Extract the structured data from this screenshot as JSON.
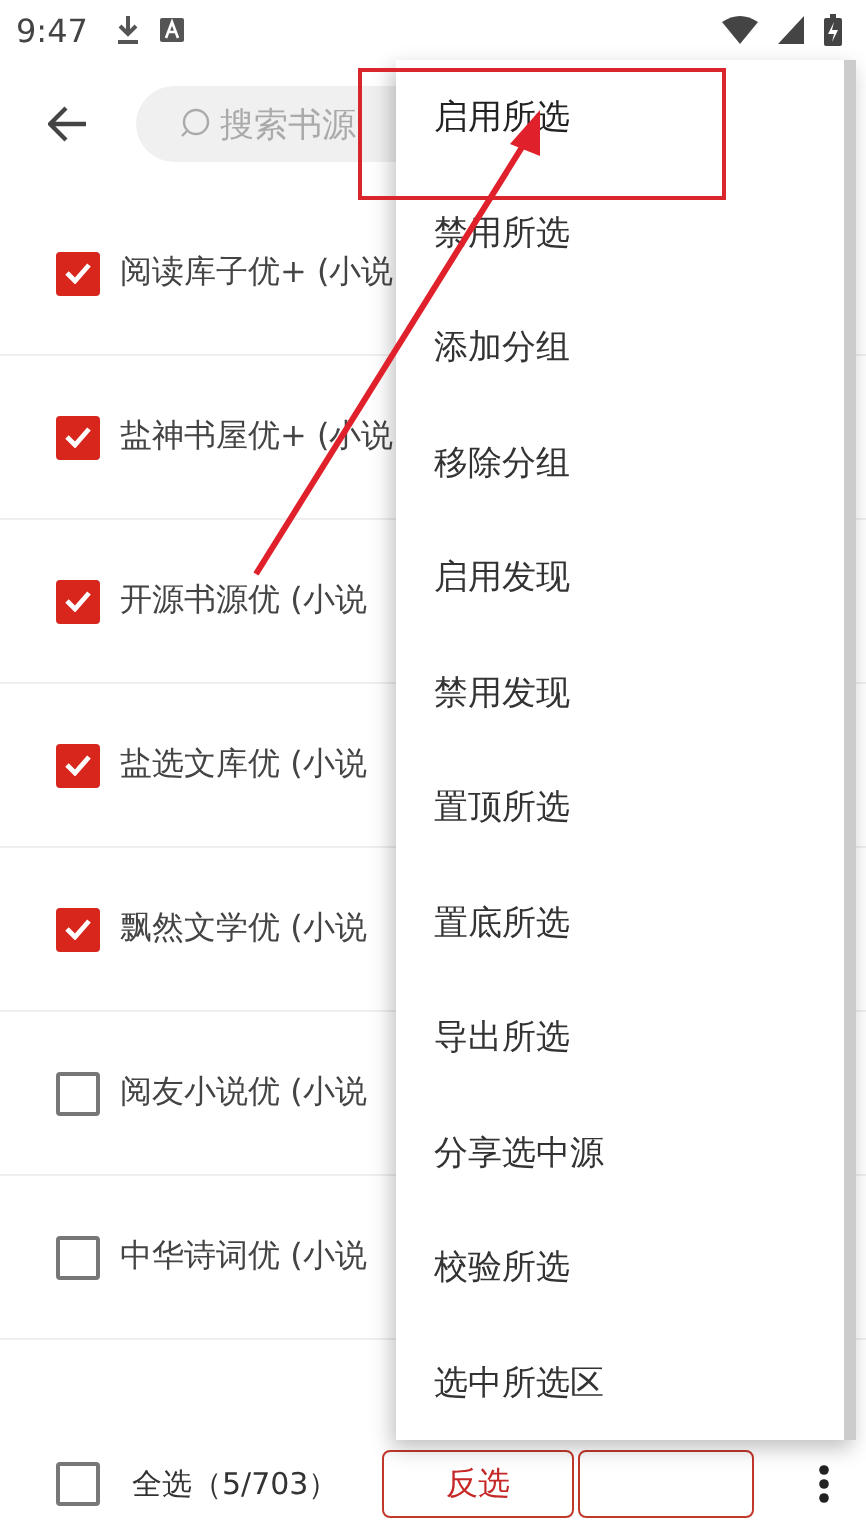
{
  "status_bar": {
    "time": "9:47"
  },
  "search": {
    "placeholder": "搜索书源"
  },
  "sources": [
    {
      "name": "阅读库子优+ (小说",
      "checked": true
    },
    {
      "name": "盐神书屋优+ (小说",
      "checked": true
    },
    {
      "name": "开源书源优 (小说",
      "checked": true
    },
    {
      "name": "盐选文库优 (小说",
      "checked": true
    },
    {
      "name": "飘然文学优 (小说",
      "checked": true
    },
    {
      "name": "阅友小说优 (小说",
      "checked": false
    },
    {
      "name": "中华诗词优 (小说",
      "checked": false
    }
  ],
  "menu": {
    "items": [
      {
        "label": "启用所选",
        "selected": true
      },
      {
        "label": "禁用所选",
        "selected": false
      },
      {
        "label": "添加分组",
        "selected": false
      },
      {
        "label": "移除分组",
        "selected": false
      },
      {
        "label": "启用发现",
        "selected": false
      },
      {
        "label": "禁用发现",
        "selected": false
      },
      {
        "label": "置顶所选",
        "selected": false
      },
      {
        "label": "置底所选",
        "selected": false
      },
      {
        "label": "导出所选",
        "selected": false
      },
      {
        "label": "分享选中源",
        "selected": false
      },
      {
        "label": "校验所选",
        "selected": false
      },
      {
        "label": "选中所选区",
        "selected": false
      }
    ]
  },
  "bottom_bar": {
    "select_all": {
      "label": "全选（5/703）",
      "checked": false
    },
    "invert_button": "反选"
  }
}
